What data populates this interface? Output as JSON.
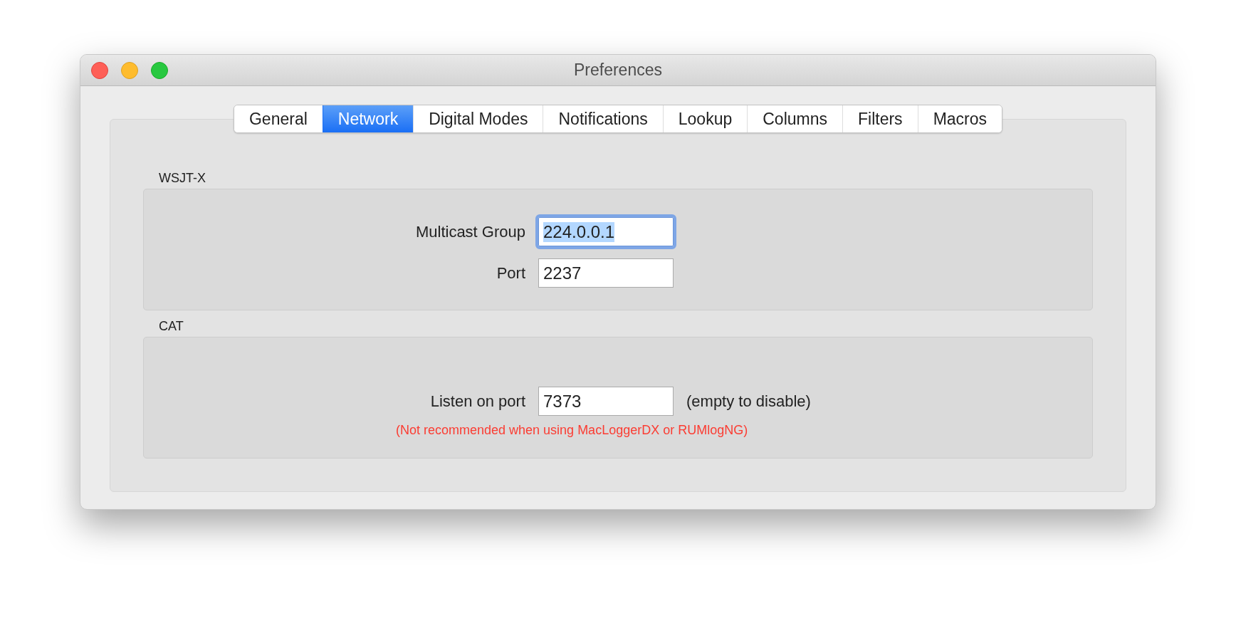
{
  "window": {
    "title": "Preferences"
  },
  "tabs": [
    {
      "label": "General",
      "selected": false
    },
    {
      "label": "Network",
      "selected": true
    },
    {
      "label": "Digital Modes",
      "selected": false
    },
    {
      "label": "Notifications",
      "selected": false
    },
    {
      "label": "Lookup",
      "selected": false
    },
    {
      "label": "Columns",
      "selected": false
    },
    {
      "label": "Filters",
      "selected": false
    },
    {
      "label": "Macros",
      "selected": false
    }
  ],
  "groups": [
    {
      "title": "WSJT-X",
      "fields": [
        {
          "label": "Multicast Group",
          "value": "224.0.0.1",
          "focused": true
        },
        {
          "label": "Port",
          "value": "2237",
          "focused": false
        }
      ]
    },
    {
      "title": "CAT",
      "fields": [
        {
          "label": "Listen on port",
          "value": "7373",
          "focused": false,
          "hint": "(empty to disable)"
        }
      ],
      "note": "(Not recommended when using MacLoggerDX or RUMlogNG)"
    }
  ]
}
